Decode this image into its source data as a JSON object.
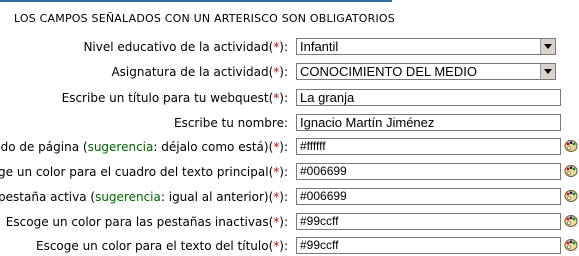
{
  "notice": "LOS CAMPOS SEÑALADOS CON UN ARTERISCO SON OBLIGATORIOS",
  "asterisk": "*",
  "rows": [
    {
      "label": "Nivel educativo de la actividad",
      "value": "Infantil"
    },
    {
      "label": "Asignatura de la actividad",
      "value": "CONOCIMIENTO DEL MEDIO"
    },
    {
      "label": "Escribe un título para tu webquest",
      "value": "La granja"
    },
    {
      "label": "Escribe tu nombre:",
      "value": "Ignacio Martín Jiménez"
    },
    {
      "label_pre": "ndo de página (",
      "sug": "sugerencia",
      "label_post": ": déjalo como está)",
      "value": "#ffffff"
    },
    {
      "label": "oge un color para el cuadro del texto principal",
      "value": "#006699"
    },
    {
      "label_pre": " pestaña activa (",
      "sug": "sugerencia",
      "label_post": ": igual al anterior)",
      "value": "#006699"
    },
    {
      "label": "Escoge un color para las pestañas inactivas",
      "value": "#99ccff"
    },
    {
      "label": "Escoge un color para el texto del título",
      "value": "#99ccff"
    }
  ],
  "icons": {
    "palette": "palette-icon",
    "dropdown": "chevron-down-icon"
  },
  "colors": {
    "required": "#cc0000",
    "suggestion": "#006600",
    "rule": "#2e6b9e"
  }
}
